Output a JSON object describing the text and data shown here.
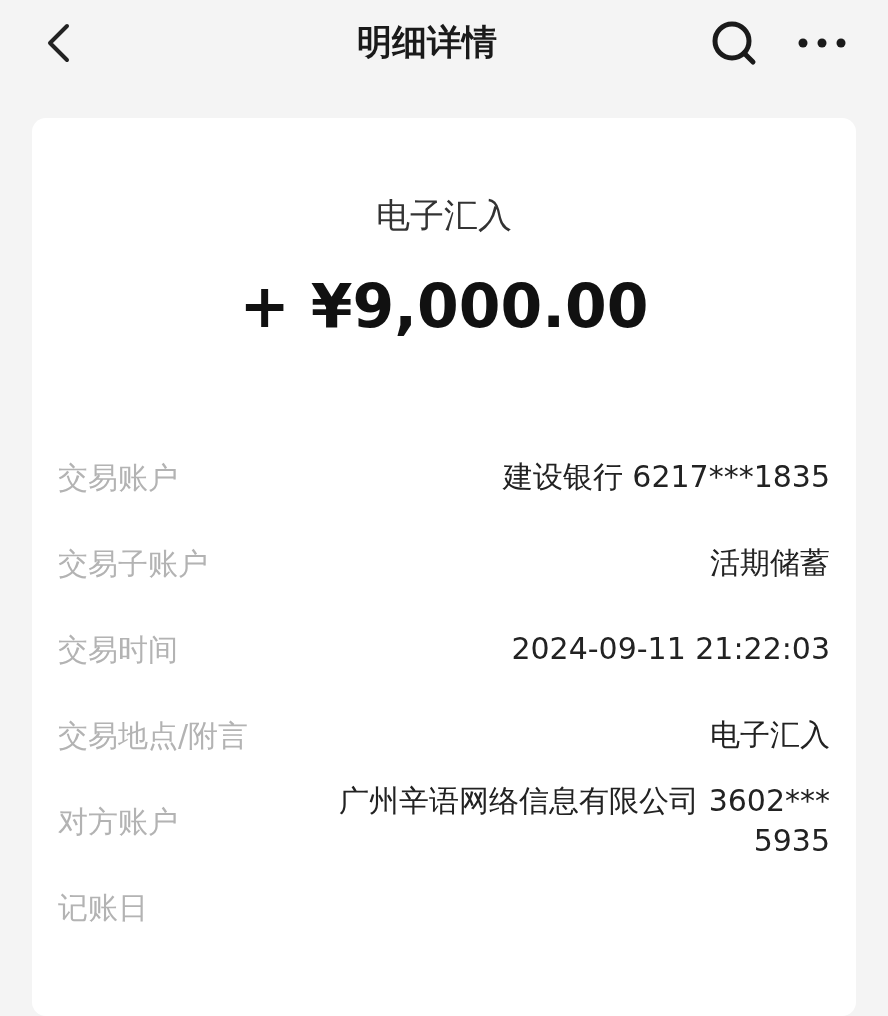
{
  "header": {
    "title": "明细详情"
  },
  "summary": {
    "type": "电子汇入",
    "amount": "+ ¥9,000.00"
  },
  "details": [
    {
      "label": "交易账户",
      "value": "建设银行 6217***1835"
    },
    {
      "label": "交易子账户",
      "value": "活期储蓄"
    },
    {
      "label": "交易时间",
      "value": "2024-09-11 21:22:03"
    },
    {
      "label": "交易地点/附言",
      "value": "电子汇入"
    },
    {
      "label": "对方账户",
      "value": "广州辛语网络信息有限公司 3602***\n5935"
    },
    {
      "label": "记账日"
    }
  ]
}
